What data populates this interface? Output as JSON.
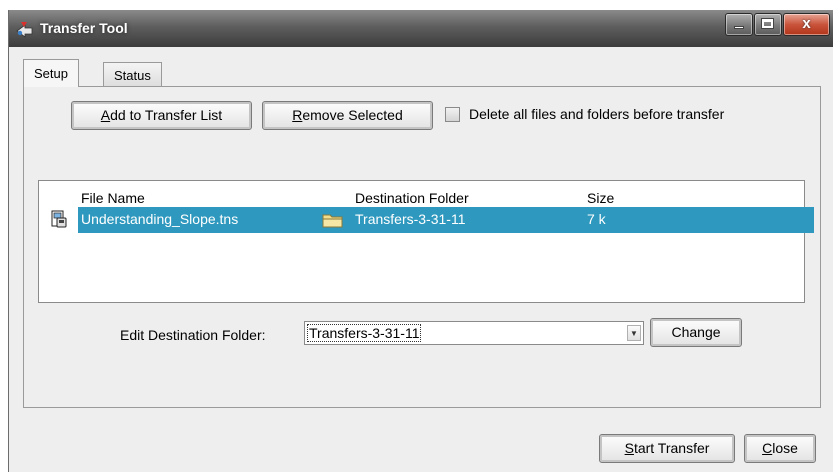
{
  "window": {
    "title": "Transfer Tool",
    "close_glyph": "x"
  },
  "tabs": [
    {
      "label": "Setup",
      "active": true
    },
    {
      "label": "Status",
      "active": false
    }
  ],
  "toolbar": {
    "add_label_u": "A",
    "add_label_rest": "dd to Transfer List",
    "remove_label_u": "R",
    "remove_label_rest": "emove Selected",
    "delete_checkbox_label": "Delete all files and folders before transfer",
    "delete_checkbox_checked": false
  },
  "table": {
    "columns": [
      "File Name",
      "Destination Folder",
      "Size"
    ],
    "rows": [
      {
        "file": "Understanding_Slope.tns",
        "folder": "Transfers-3-31-11",
        "size": "7 k",
        "selected": true
      }
    ]
  },
  "edit_folder": {
    "label": "Edit Destination Folder:",
    "value": "Transfers-3-31-11",
    "change_label": "Change"
  },
  "footer": {
    "start_u": "S",
    "start_rest": "tart Transfer",
    "close_u": "C",
    "close_rest": "lose"
  },
  "colors": {
    "selection": "#2e98be",
    "titlebar": "#4a4a4a",
    "close_button": "#c9543c"
  },
  "icons": {
    "app": "transfer-app-icon",
    "file": "tns-file-icon",
    "folder": "folder-icon"
  }
}
